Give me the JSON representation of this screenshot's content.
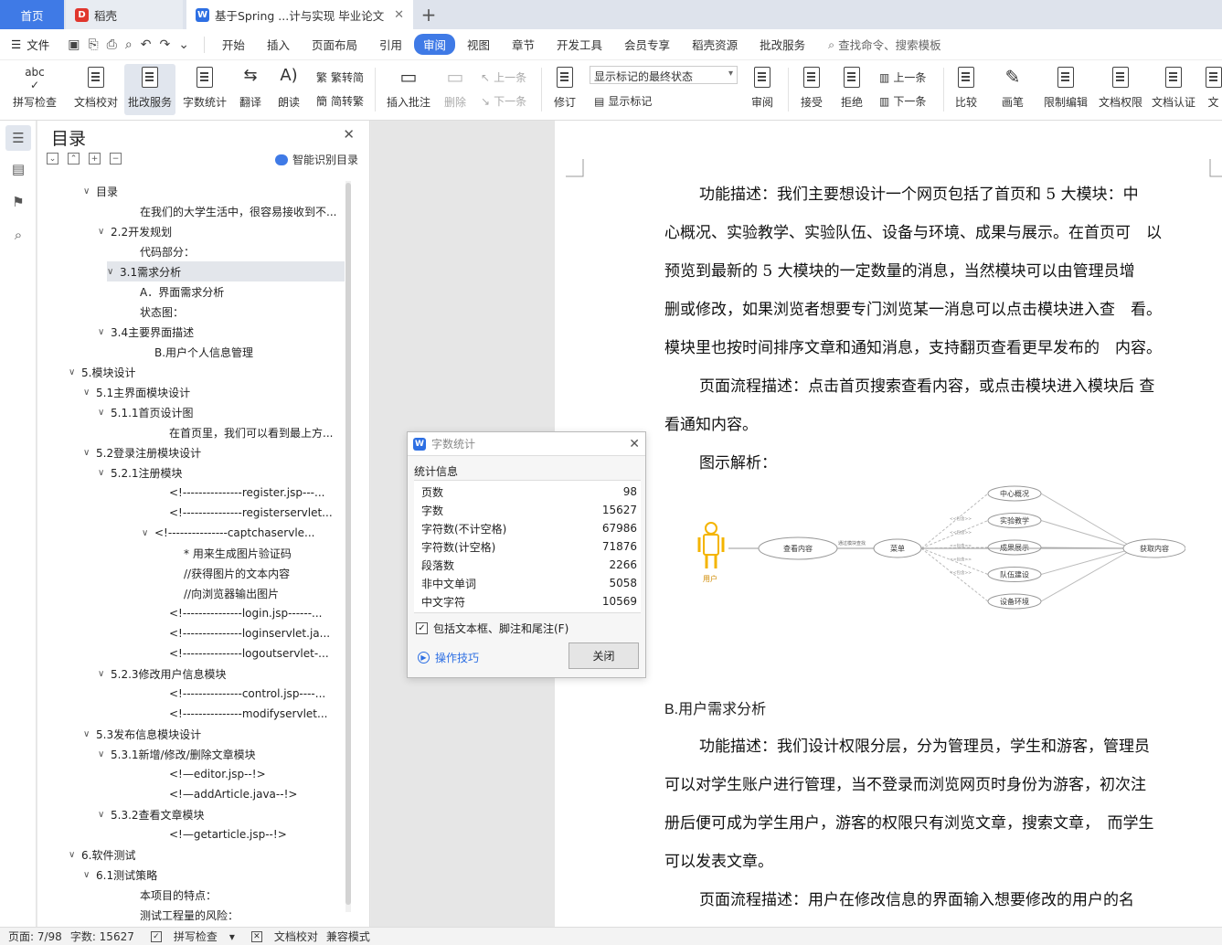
{
  "tabs": {
    "home": "首页",
    "daoke": "稻壳",
    "doc": "基于Spring ...计与实现 毕业论文"
  },
  "menu": {
    "file": "文件",
    "items": [
      "开始",
      "插入",
      "页面布局",
      "引用",
      "审阅",
      "视图",
      "章节",
      "开发工具",
      "会员专享",
      "稻壳资源",
      "批改服务"
    ],
    "active_index": 4,
    "search": "查找命令、搜索模板"
  },
  "ribbon": {
    "spell": "拼写检查",
    "proof": "文档校对",
    "correct": "批改服务",
    "wordcount": "字数统计",
    "translate": "翻译",
    "read": "朗读",
    "trad": "繁转简",
    "simp": "简转繁",
    "insert_comment": "插入批注",
    "delete": "删除",
    "prev": "上一条",
    "next": "下一条",
    "revise": "修订",
    "markup_select": "显示标记的最终状态",
    "show_markup": "显示标记",
    "review": "审阅",
    "accept": "接受",
    "reject": "拒绝",
    "prev2": "上一条",
    "next2": "下一条",
    "compare": "比较",
    "pen": "画笔",
    "restrict": "限制编辑",
    "perm": "文档权限",
    "cert": "文档认证",
    "more": "文"
  },
  "toc": {
    "title": "目录",
    "smart": "智能识别目录",
    "items": [
      {
        "label": "目录",
        "level": 2,
        "chev": "v"
      },
      {
        "label": "在我们的大学生活中，很容易接收到不...",
        "level": 4,
        "chev": ""
      },
      {
        "label": "2.2开发规划",
        "level": 3,
        "chev": "v"
      },
      {
        "label": "代码部分：",
        "level": 4,
        "chev": ""
      },
      {
        "label": "3.1需求分析",
        "level": 3,
        "chev": "v",
        "selected": true
      },
      {
        "label": "A．界面需求分析",
        "level": 4,
        "chev": ""
      },
      {
        "label": "状态图：",
        "level": 4,
        "chev": ""
      },
      {
        "label": "3.4主要界面描述",
        "level": 2.5,
        "chev": "v"
      },
      {
        "label": "B.用户个人信息管理",
        "level": 5,
        "chev": ""
      },
      {
        "label": "5.模块设计",
        "level": 1,
        "chev": "v"
      },
      {
        "label": "5.1主界面模块设计",
        "level": 2,
        "chev": "v"
      },
      {
        "label": "5.1.1首页设计图",
        "level": 3,
        "chev": "v"
      },
      {
        "label": "在首页里，我们可以看到最上方...",
        "level": 6,
        "chev": ""
      },
      {
        "label": "5.2登录注册模块设计",
        "level": 2,
        "chev": "v"
      },
      {
        "label": "5.2.1注册模块",
        "level": 3,
        "chev": "v"
      },
      {
        "label": "<!---------------register.jsp---...",
        "level": 6,
        "chev": ""
      },
      {
        "label": "<!---------------registerservlet...",
        "level": 6,
        "chev": ""
      },
      {
        "label": "<!---------------captchaservle...",
        "level": 5,
        "chev": "v"
      },
      {
        "label": "* 用来生成图片验证码",
        "level": 7,
        "chev": ""
      },
      {
        "label": "//获得图片的文本内容",
        "level": 7,
        "chev": ""
      },
      {
        "label": "//向浏览器输出图片",
        "level": 7,
        "chev": ""
      },
      {
        "label": "<!---------------login.jsp------...",
        "level": 6,
        "chev": ""
      },
      {
        "label": "<!---------------loginservlet.ja...",
        "level": 6,
        "chev": ""
      },
      {
        "label": "<!---------------logoutservlet-...",
        "level": 6,
        "chev": ""
      },
      {
        "label": "5.2.3修改用户信息模块",
        "level": 3,
        "chev": "v"
      },
      {
        "label": "<!---------------control.jsp----...",
        "level": 6,
        "chev": ""
      },
      {
        "label": "<!---------------modifyservlet...",
        "level": 6,
        "chev": ""
      },
      {
        "label": "5.3发布信息模块设计",
        "level": 2,
        "chev": "v"
      },
      {
        "label": "5.3.1新增/修改/删除文章模块",
        "level": 3,
        "chev": "v"
      },
      {
        "label": "<!—editor.jsp--!>",
        "level": 6,
        "chev": ""
      },
      {
        "label": "<!—addArticle.java--!>",
        "level": 6,
        "chev": ""
      },
      {
        "label": "5.3.2查看文章模块",
        "level": 3,
        "chev": "v"
      },
      {
        "label": "<!—getarticle.jsp--!>",
        "level": 6,
        "chev": ""
      },
      {
        "label": "6.软件测试",
        "level": 1,
        "chev": "v"
      },
      {
        "label": "6.1测试策略",
        "level": 2,
        "chev": "v"
      },
      {
        "label": "本项目的特点：",
        "level": 4,
        "chev": ""
      },
      {
        "label": "测试工程量的风险：",
        "level": 4,
        "chev": ""
      }
    ]
  },
  "document": {
    "lines": [
      {
        "text": "功能描述：我们主要想设计一个网页包括了首页和 5 大模块：中",
        "indent": true
      },
      {
        "text": "心概况、实验教学、实验队伍、设备与环境、成果与展示。在首页可　以",
        "indent": false
      },
      {
        "text": "预览到最新的 5 大模块的一定数量的消息，当然模块可以由管理员增",
        "indent": false
      },
      {
        "text": "删或修改，如果浏览者想要专门浏览某一消息可以点击模块进入查　看。",
        "indent": false
      },
      {
        "text": "模块里也按时间排序文章和通知消息，支持翻页查看更早发布的　内容。",
        "indent": false
      },
      {
        "text": "页面流程描述：点击首页搜索查看内容，或点击模块进入模块后 查",
        "indent": true
      },
      {
        "text": "看通知内容。",
        "indent": false
      },
      {
        "text": "图示解析：",
        "indent": true
      }
    ],
    "heading": "B.用户需求分析",
    "lines2": [
      {
        "text": "功能描述：我们设计权限分层，分为管理员，学生和游客，管理员",
        "indent": true
      },
      {
        "text": "可以对学生账户进行管理，当不登录而浏览网页时身份为游客，初次注",
        "indent": false
      },
      {
        "text": "册后便可成为学生用户，游客的权限只有浏览文章，搜索文章，　而学生",
        "indent": false
      },
      {
        "text": "可以发表文章。",
        "indent": false
      },
      {
        "text": "页面流程描述：用户在修改信息的界面输入想要修改的用户的名",
        "indent": true
      }
    ],
    "diagram": {
      "actor": "用户",
      "view": "查看内容",
      "edge_label": "通过模块查找",
      "menu": "菜单",
      "modules": [
        "中心概况",
        "实验教学",
        "成果展示",
        "队伍建设",
        "设备环境"
      ],
      "include": "<<包含>>",
      "result": "获取内容"
    }
  },
  "dialog": {
    "title": "字数统计",
    "section": "统计信息",
    "rows": [
      {
        "k": "页数",
        "v": "98"
      },
      {
        "k": "字数",
        "v": "15627"
      },
      {
        "k": "字符数(不计空格)",
        "v": "67986"
      },
      {
        "k": "字符数(计空格)",
        "v": "71876"
      },
      {
        "k": "段落数",
        "v": "2266"
      },
      {
        "k": "非中文单词",
        "v": "5058"
      },
      {
        "k": "中文字符",
        "v": "10569"
      }
    ],
    "include": "包括文本框、脚注和尾注(F)",
    "tips": "操作技巧",
    "close": "关闭"
  },
  "status": {
    "page": "页面: 7/98",
    "words": "字数: 15627",
    "spell": "拼写检查",
    "proof": "文档校对",
    "compat": "兼容模式"
  },
  "colors": {
    "accent": "#3f7ae6",
    "actor": "#f4b400"
  }
}
